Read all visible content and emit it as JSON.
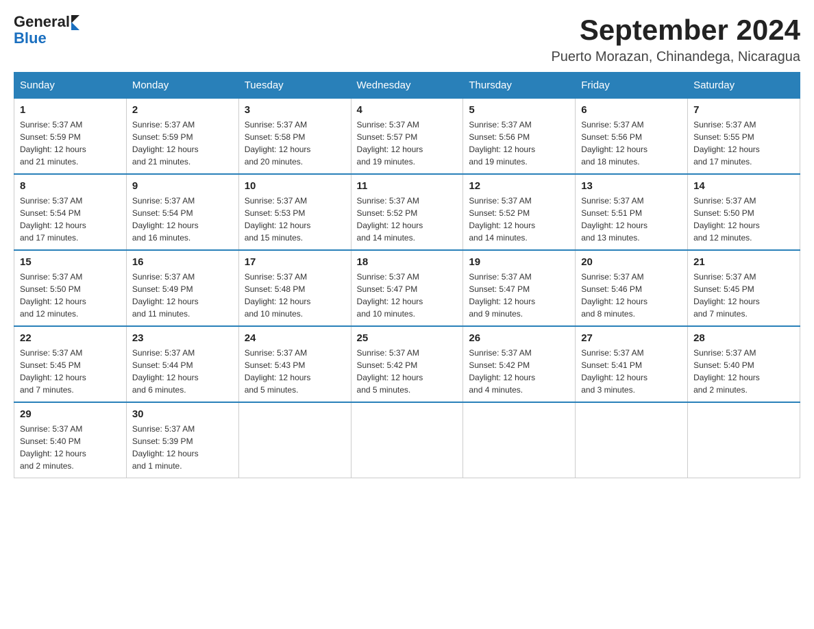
{
  "logo": {
    "text_general": "General",
    "text_blue": "Blue"
  },
  "title": "September 2024",
  "subtitle": "Puerto Morazan, Chinandega, Nicaragua",
  "days_of_week": [
    "Sunday",
    "Monday",
    "Tuesday",
    "Wednesday",
    "Thursday",
    "Friday",
    "Saturday"
  ],
  "weeks": [
    [
      {
        "day": "1",
        "sunrise": "5:37 AM",
        "sunset": "5:59 PM",
        "daylight": "12 hours and 21 minutes."
      },
      {
        "day": "2",
        "sunrise": "5:37 AM",
        "sunset": "5:59 PM",
        "daylight": "12 hours and 21 minutes."
      },
      {
        "day": "3",
        "sunrise": "5:37 AM",
        "sunset": "5:58 PM",
        "daylight": "12 hours and 20 minutes."
      },
      {
        "day": "4",
        "sunrise": "5:37 AM",
        "sunset": "5:57 PM",
        "daylight": "12 hours and 19 minutes."
      },
      {
        "day": "5",
        "sunrise": "5:37 AM",
        "sunset": "5:56 PM",
        "daylight": "12 hours and 19 minutes."
      },
      {
        "day": "6",
        "sunrise": "5:37 AM",
        "sunset": "5:56 PM",
        "daylight": "12 hours and 18 minutes."
      },
      {
        "day": "7",
        "sunrise": "5:37 AM",
        "sunset": "5:55 PM",
        "daylight": "12 hours and 17 minutes."
      }
    ],
    [
      {
        "day": "8",
        "sunrise": "5:37 AM",
        "sunset": "5:54 PM",
        "daylight": "12 hours and 17 minutes."
      },
      {
        "day": "9",
        "sunrise": "5:37 AM",
        "sunset": "5:54 PM",
        "daylight": "12 hours and 16 minutes."
      },
      {
        "day": "10",
        "sunrise": "5:37 AM",
        "sunset": "5:53 PM",
        "daylight": "12 hours and 15 minutes."
      },
      {
        "day": "11",
        "sunrise": "5:37 AM",
        "sunset": "5:52 PM",
        "daylight": "12 hours and 14 minutes."
      },
      {
        "day": "12",
        "sunrise": "5:37 AM",
        "sunset": "5:52 PM",
        "daylight": "12 hours and 14 minutes."
      },
      {
        "day": "13",
        "sunrise": "5:37 AM",
        "sunset": "5:51 PM",
        "daylight": "12 hours and 13 minutes."
      },
      {
        "day": "14",
        "sunrise": "5:37 AM",
        "sunset": "5:50 PM",
        "daylight": "12 hours and 12 minutes."
      }
    ],
    [
      {
        "day": "15",
        "sunrise": "5:37 AM",
        "sunset": "5:50 PM",
        "daylight": "12 hours and 12 minutes."
      },
      {
        "day": "16",
        "sunrise": "5:37 AM",
        "sunset": "5:49 PM",
        "daylight": "12 hours and 11 minutes."
      },
      {
        "day": "17",
        "sunrise": "5:37 AM",
        "sunset": "5:48 PM",
        "daylight": "12 hours and 10 minutes."
      },
      {
        "day": "18",
        "sunrise": "5:37 AM",
        "sunset": "5:47 PM",
        "daylight": "12 hours and 10 minutes."
      },
      {
        "day": "19",
        "sunrise": "5:37 AM",
        "sunset": "5:47 PM",
        "daylight": "12 hours and 9 minutes."
      },
      {
        "day": "20",
        "sunrise": "5:37 AM",
        "sunset": "5:46 PM",
        "daylight": "12 hours and 8 minutes."
      },
      {
        "day": "21",
        "sunrise": "5:37 AM",
        "sunset": "5:45 PM",
        "daylight": "12 hours and 7 minutes."
      }
    ],
    [
      {
        "day": "22",
        "sunrise": "5:37 AM",
        "sunset": "5:45 PM",
        "daylight": "12 hours and 7 minutes."
      },
      {
        "day": "23",
        "sunrise": "5:37 AM",
        "sunset": "5:44 PM",
        "daylight": "12 hours and 6 minutes."
      },
      {
        "day": "24",
        "sunrise": "5:37 AM",
        "sunset": "5:43 PM",
        "daylight": "12 hours and 5 minutes."
      },
      {
        "day": "25",
        "sunrise": "5:37 AM",
        "sunset": "5:42 PM",
        "daylight": "12 hours and 5 minutes."
      },
      {
        "day": "26",
        "sunrise": "5:37 AM",
        "sunset": "5:42 PM",
        "daylight": "12 hours and 4 minutes."
      },
      {
        "day": "27",
        "sunrise": "5:37 AM",
        "sunset": "5:41 PM",
        "daylight": "12 hours and 3 minutes."
      },
      {
        "day": "28",
        "sunrise": "5:37 AM",
        "sunset": "5:40 PM",
        "daylight": "12 hours and 2 minutes."
      }
    ],
    [
      {
        "day": "29",
        "sunrise": "5:37 AM",
        "sunset": "5:40 PM",
        "daylight": "12 hours and 2 minutes."
      },
      {
        "day": "30",
        "sunrise": "5:37 AM",
        "sunset": "5:39 PM",
        "daylight": "12 hours and 1 minute."
      },
      null,
      null,
      null,
      null,
      null
    ]
  ]
}
